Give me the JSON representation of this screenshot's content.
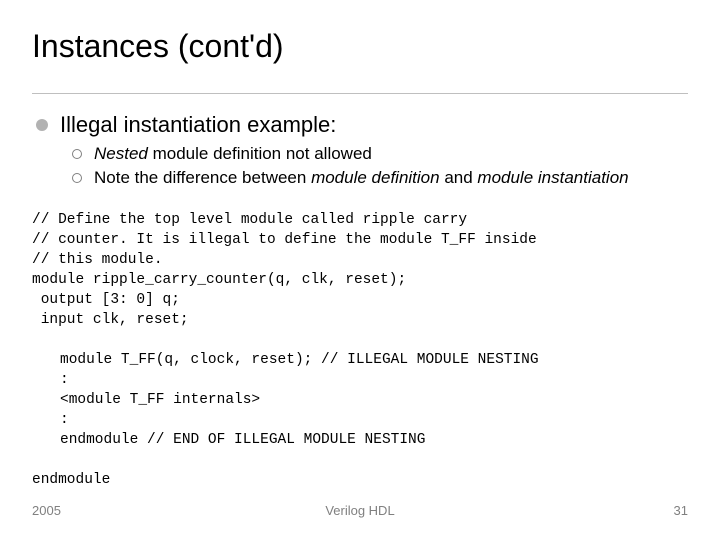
{
  "title": "Instances (cont'd)",
  "bullets": {
    "main": "Illegal instantiation example:",
    "sub1_italic": "Nested",
    "sub1_rest": " module definition not allowed",
    "sub2_a": "Note the difference between ",
    "sub2_b": "module definition",
    "sub2_c": " and ",
    "sub2_d": "module instantiation"
  },
  "code": {
    "block1": "// Define the top level module called ripple carry\n// counter. It is illegal to define the module T_FF inside\n// this module.\nmodule ripple_carry_counter(q, clk, reset);\n output [3: 0] q;\n input clk, reset;",
    "block2": "module T_FF(q, clock, reset); // ILLEGAL MODULE NESTING\n:\n<module T_FF internals>\n:\nendmodule // END OF ILLEGAL MODULE NESTING",
    "block3": "endmodule"
  },
  "footer": {
    "left": "2005",
    "center": "Verilog HDL",
    "right": "31"
  }
}
